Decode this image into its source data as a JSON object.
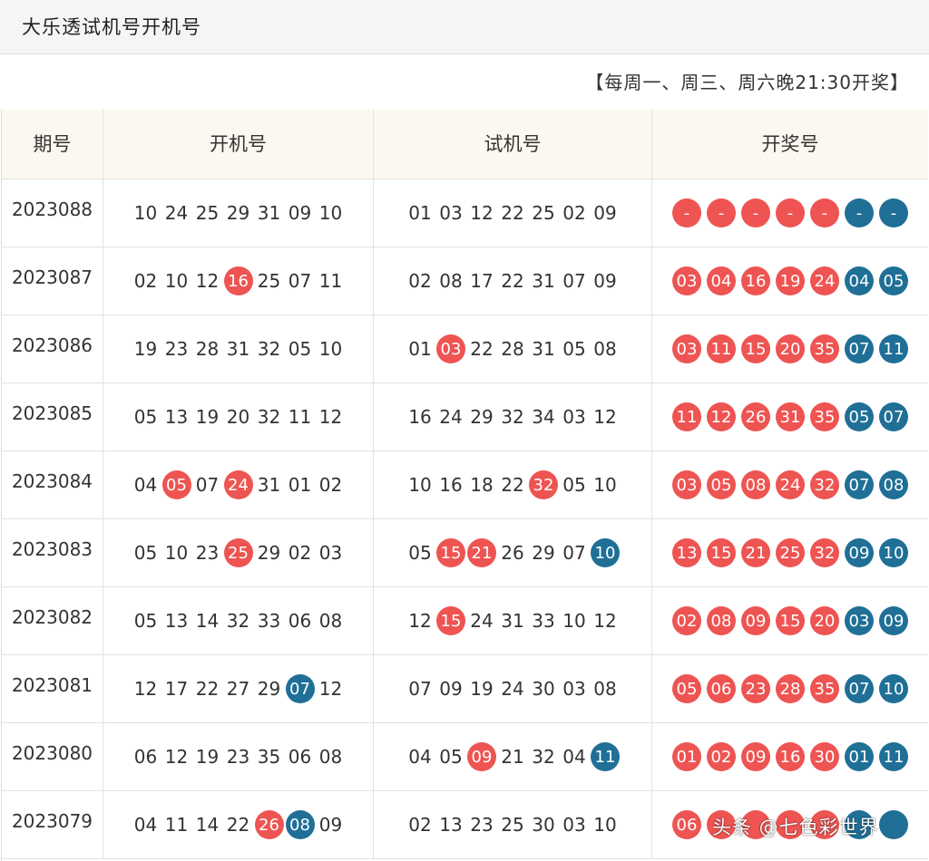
{
  "page_title": "大乐透试机号开机号",
  "schedule_note": "【每周一、周三、周六晚21:30开奖】",
  "columns": [
    "期号",
    "开机号",
    "试机号",
    "开奖号"
  ],
  "colors": {
    "red_ball": "#ee5452",
    "blue_ball": "#1f6f96",
    "header_bg": "#fdf8ef"
  },
  "rows": [
    {
      "issue": "2023088",
      "open": [
        [
          "10",
          ""
        ],
        [
          "24",
          ""
        ],
        [
          "25",
          ""
        ],
        [
          "29",
          ""
        ],
        [
          "31",
          ""
        ],
        [
          "09",
          ""
        ],
        [
          "10",
          ""
        ]
      ],
      "trial": [
        [
          "01",
          ""
        ],
        [
          "03",
          ""
        ],
        [
          "12",
          ""
        ],
        [
          "22",
          ""
        ],
        [
          "25",
          ""
        ],
        [
          "02",
          ""
        ],
        [
          "09",
          ""
        ]
      ],
      "draw": [
        [
          "-",
          "red"
        ],
        [
          "-",
          "red"
        ],
        [
          "-",
          "red"
        ],
        [
          "-",
          "red"
        ],
        [
          "-",
          "red"
        ],
        [
          "-",
          "blue"
        ],
        [
          "-",
          "blue"
        ]
      ]
    },
    {
      "issue": "2023087",
      "open": [
        [
          "02",
          ""
        ],
        [
          "10",
          ""
        ],
        [
          "12",
          ""
        ],
        [
          "16",
          "red"
        ],
        [
          "25",
          ""
        ],
        [
          "07",
          ""
        ],
        [
          "11",
          ""
        ]
      ],
      "trial": [
        [
          "02",
          ""
        ],
        [
          "08",
          ""
        ],
        [
          "17",
          ""
        ],
        [
          "22",
          ""
        ],
        [
          "31",
          ""
        ],
        [
          "07",
          ""
        ],
        [
          "09",
          ""
        ]
      ],
      "draw": [
        [
          "03",
          "red"
        ],
        [
          "04",
          "red"
        ],
        [
          "16",
          "red"
        ],
        [
          "19",
          "red"
        ],
        [
          "24",
          "red"
        ],
        [
          "04",
          "blue"
        ],
        [
          "05",
          "blue"
        ]
      ]
    },
    {
      "issue": "2023086",
      "open": [
        [
          "19",
          ""
        ],
        [
          "23",
          ""
        ],
        [
          "28",
          ""
        ],
        [
          "31",
          ""
        ],
        [
          "32",
          ""
        ],
        [
          "05",
          ""
        ],
        [
          "10",
          ""
        ]
      ],
      "trial": [
        [
          "01",
          ""
        ],
        [
          "03",
          "red"
        ],
        [
          "22",
          ""
        ],
        [
          "28",
          ""
        ],
        [
          "31",
          ""
        ],
        [
          "05",
          ""
        ],
        [
          "08",
          ""
        ]
      ],
      "draw": [
        [
          "03",
          "red"
        ],
        [
          "11",
          "red"
        ],
        [
          "15",
          "red"
        ],
        [
          "20",
          "red"
        ],
        [
          "35",
          "red"
        ],
        [
          "07",
          "blue"
        ],
        [
          "11",
          "blue"
        ]
      ]
    },
    {
      "issue": "2023085",
      "open": [
        [
          "05",
          ""
        ],
        [
          "13",
          ""
        ],
        [
          "19",
          ""
        ],
        [
          "20",
          ""
        ],
        [
          "32",
          ""
        ],
        [
          "11",
          ""
        ],
        [
          "12",
          ""
        ]
      ],
      "trial": [
        [
          "16",
          ""
        ],
        [
          "24",
          ""
        ],
        [
          "29",
          ""
        ],
        [
          "32",
          ""
        ],
        [
          "34",
          ""
        ],
        [
          "03",
          ""
        ],
        [
          "12",
          ""
        ]
      ],
      "draw": [
        [
          "11",
          "red"
        ],
        [
          "12",
          "red"
        ],
        [
          "26",
          "red"
        ],
        [
          "31",
          "red"
        ],
        [
          "35",
          "red"
        ],
        [
          "05",
          "blue"
        ],
        [
          "07",
          "blue"
        ]
      ]
    },
    {
      "issue": "2023084",
      "open": [
        [
          "04",
          ""
        ],
        [
          "05",
          "red"
        ],
        [
          "07",
          ""
        ],
        [
          "24",
          "red"
        ],
        [
          "31",
          ""
        ],
        [
          "01",
          ""
        ],
        [
          "02",
          ""
        ]
      ],
      "trial": [
        [
          "10",
          ""
        ],
        [
          "16",
          ""
        ],
        [
          "18",
          ""
        ],
        [
          "22",
          ""
        ],
        [
          "32",
          "red"
        ],
        [
          "05",
          ""
        ],
        [
          "10",
          ""
        ]
      ],
      "draw": [
        [
          "03",
          "red"
        ],
        [
          "05",
          "red"
        ],
        [
          "08",
          "red"
        ],
        [
          "24",
          "red"
        ],
        [
          "32",
          "red"
        ],
        [
          "07",
          "blue"
        ],
        [
          "08",
          "blue"
        ]
      ]
    },
    {
      "issue": "2023083",
      "open": [
        [
          "05",
          ""
        ],
        [
          "10",
          ""
        ],
        [
          "23",
          ""
        ],
        [
          "25",
          "red"
        ],
        [
          "29",
          ""
        ],
        [
          "02",
          ""
        ],
        [
          "03",
          ""
        ]
      ],
      "trial": [
        [
          "05",
          ""
        ],
        [
          "15",
          "red"
        ],
        [
          "21",
          "red"
        ],
        [
          "26",
          ""
        ],
        [
          "29",
          ""
        ],
        [
          "07",
          ""
        ],
        [
          "10",
          "blue"
        ]
      ],
      "draw": [
        [
          "13",
          "red"
        ],
        [
          "15",
          "red"
        ],
        [
          "21",
          "red"
        ],
        [
          "25",
          "red"
        ],
        [
          "32",
          "red"
        ],
        [
          "09",
          "blue"
        ],
        [
          "10",
          "blue"
        ]
      ]
    },
    {
      "issue": "2023082",
      "open": [
        [
          "05",
          ""
        ],
        [
          "13",
          ""
        ],
        [
          "14",
          ""
        ],
        [
          "32",
          ""
        ],
        [
          "33",
          ""
        ],
        [
          "06",
          ""
        ],
        [
          "08",
          ""
        ]
      ],
      "trial": [
        [
          "12",
          ""
        ],
        [
          "15",
          "red"
        ],
        [
          "24",
          ""
        ],
        [
          "31",
          ""
        ],
        [
          "33",
          ""
        ],
        [
          "10",
          ""
        ],
        [
          "12",
          ""
        ]
      ],
      "draw": [
        [
          "02",
          "red"
        ],
        [
          "08",
          "red"
        ],
        [
          "09",
          "red"
        ],
        [
          "15",
          "red"
        ],
        [
          "20",
          "red"
        ],
        [
          "03",
          "blue"
        ],
        [
          "09",
          "blue"
        ]
      ]
    },
    {
      "issue": "2023081",
      "open": [
        [
          "12",
          ""
        ],
        [
          "17",
          ""
        ],
        [
          "22",
          ""
        ],
        [
          "27",
          ""
        ],
        [
          "29",
          ""
        ],
        [
          "07",
          "blue"
        ],
        [
          "12",
          ""
        ]
      ],
      "trial": [
        [
          "07",
          ""
        ],
        [
          "09",
          ""
        ],
        [
          "19",
          ""
        ],
        [
          "24",
          ""
        ],
        [
          "30",
          ""
        ],
        [
          "03",
          ""
        ],
        [
          "08",
          ""
        ]
      ],
      "draw": [
        [
          "05",
          "red"
        ],
        [
          "06",
          "red"
        ],
        [
          "23",
          "red"
        ],
        [
          "28",
          "red"
        ],
        [
          "35",
          "red"
        ],
        [
          "07",
          "blue"
        ],
        [
          "10",
          "blue"
        ]
      ]
    },
    {
      "issue": "2023080",
      "open": [
        [
          "06",
          ""
        ],
        [
          "12",
          ""
        ],
        [
          "19",
          ""
        ],
        [
          "23",
          ""
        ],
        [
          "35",
          ""
        ],
        [
          "06",
          ""
        ],
        [
          "08",
          ""
        ]
      ],
      "trial": [
        [
          "04",
          ""
        ],
        [
          "05",
          ""
        ],
        [
          "09",
          "red"
        ],
        [
          "21",
          ""
        ],
        [
          "32",
          ""
        ],
        [
          "04",
          ""
        ],
        [
          "11",
          "blue"
        ]
      ],
      "draw": [
        [
          "01",
          "red"
        ],
        [
          "02",
          "red"
        ],
        [
          "09",
          "red"
        ],
        [
          "16",
          "red"
        ],
        [
          "30",
          "red"
        ],
        [
          "01",
          "blue"
        ],
        [
          "11",
          "blue"
        ]
      ]
    },
    {
      "issue": "2023079",
      "open": [
        [
          "04",
          ""
        ],
        [
          "11",
          ""
        ],
        [
          "14",
          ""
        ],
        [
          "22",
          ""
        ],
        [
          "26",
          "red"
        ],
        [
          "08",
          "blue"
        ],
        [
          "09",
          ""
        ]
      ],
      "trial": [
        [
          "02",
          ""
        ],
        [
          "13",
          ""
        ],
        [
          "23",
          ""
        ],
        [
          "25",
          ""
        ],
        [
          "30",
          ""
        ],
        [
          "03",
          ""
        ],
        [
          "10",
          ""
        ]
      ],
      "draw": [
        [
          "06",
          "red"
        ],
        [
          "",
          "red"
        ],
        [
          "",
          "red"
        ],
        [
          "",
          "red"
        ],
        [
          "",
          "red"
        ],
        [
          "",
          "blue"
        ],
        [
          "",
          "blue"
        ]
      ]
    }
  ],
  "watermark": "头条 @七色彩世界"
}
